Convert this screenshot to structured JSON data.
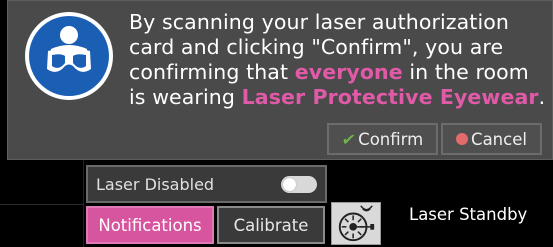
{
  "dialog": {
    "icon": "safety-goggles-icon",
    "message_part1": "By scanning your laser authorization card and clicking \"Confirm\", you are confirming that ",
    "message_hl1": "everyone",
    "message_part2": " in the room is wearing ",
    "message_hl2": "Laser Protective Eyewear",
    "message_part3": ".",
    "confirm_label": "Confirm",
    "cancel_label": "Cancel",
    "accent_color": "#e05aa8"
  },
  "controls": {
    "laser_toggle_label": "Laser Disabled",
    "laser_enabled": false,
    "notifications_label": "Notifications",
    "calibrate_label": "Calibrate",
    "laser_warning_icon": "laser-radiation-warning-icon",
    "status": "Laser Standby"
  }
}
